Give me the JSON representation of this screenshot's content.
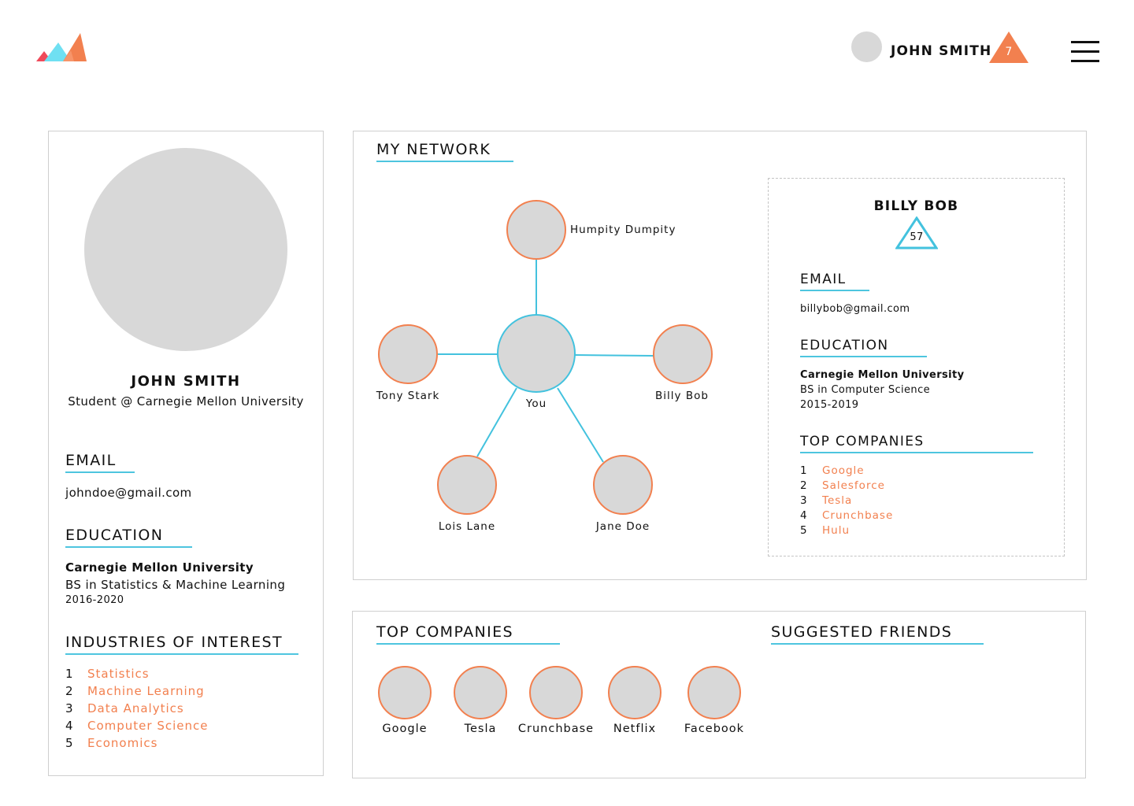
{
  "header": {
    "user_name": "JOHN SMITH",
    "notification_count": "7",
    "logo_icon": "mountains-logo-icon",
    "menu_icon": "hamburger-menu-icon"
  },
  "profile": {
    "name": "JOHN SMITH",
    "tagline": "Student @ Carnegie Mellon University",
    "email_title": "EMAIL",
    "email": "johndoe@gmail.com",
    "education_title": "EDUCATION",
    "school": "Carnegie Mellon University",
    "degree": "BS in Statistics & Machine Learning",
    "years": "2016-2020",
    "industries_title": "INDUSTRIES OF INTEREST",
    "industries": [
      {
        "num": "1",
        "label": "Statistics"
      },
      {
        "num": "2",
        "label": "Machine Learning"
      },
      {
        "num": "3",
        "label": "Data Analytics"
      },
      {
        "num": "4",
        "label": "Computer Science"
      },
      {
        "num": "5",
        "label": "Economics"
      }
    ]
  },
  "network": {
    "title": "MY NETWORK",
    "center_label": "You",
    "nodes": [
      "Humpity Dumpity",
      "Tony Stark",
      "Billy Bob",
      "Lois Lane",
      "Jane Doe"
    ]
  },
  "detail": {
    "name": "BILLY BOB",
    "score": "57",
    "email_title": "EMAIL",
    "email": "billybob@gmail.com",
    "education_title": "EDUCATION",
    "school": "Carnegie Mellon University",
    "degree": "BS in Computer Science",
    "years": "2015-2019",
    "companies_title": "TOP COMPANIES",
    "companies": [
      {
        "num": "1",
        "label": "Google"
      },
      {
        "num": "2",
        "label": "Salesforce"
      },
      {
        "num": "3",
        "label": "Tesla"
      },
      {
        "num": "4",
        "label": "Crunchbase"
      },
      {
        "num": "5",
        "label": "Hulu"
      }
    ]
  },
  "bottom": {
    "companies_title": "TOP COMPANIES",
    "companies": [
      "Google",
      "Tesla",
      "Crunchbase",
      "Netflix",
      "Facebook"
    ],
    "friends_title": "SUGGESTED FRIENDS"
  },
  "colors": {
    "accent_orange": "#f2804f",
    "accent_blue": "#43c2de",
    "placeholder_gray": "#d8d8d8"
  }
}
